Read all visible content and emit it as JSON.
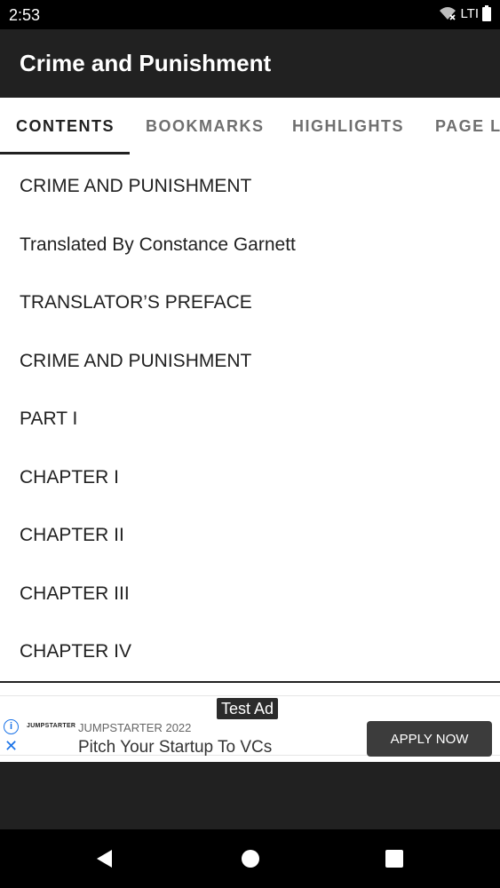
{
  "status_bar": {
    "time": "2:53",
    "network_label": "LTI"
  },
  "app_bar": {
    "title": "Crime and Punishment"
  },
  "tabs": [
    {
      "label": "CONTENTS",
      "active": true
    },
    {
      "label": "BOOKMARKS",
      "active": false
    },
    {
      "label": "HIGHLIGHTS",
      "active": false
    },
    {
      "label": "PAGE L",
      "active": false
    }
  ],
  "contents": [
    "CRIME AND PUNISHMENT",
    "Translated By Constance Garnett",
    "TRANSLATOR’S PREFACE",
    "CRIME AND PUNISHMENT",
    "PART I",
    "CHAPTER I",
    "CHAPTER II",
    "CHAPTER III",
    "CHAPTER IV"
  ],
  "ad": {
    "test_label": "Test Ad",
    "logo_text": "JUMPSTARTER",
    "sponsor": "JUMPSTARTER 2022",
    "headline": "Pitch Your Startup To VCs",
    "cta": "APPLY NOW"
  },
  "nav": {
    "back_icon": "triangle-left",
    "home_icon": "circle",
    "recents_icon": "square"
  }
}
